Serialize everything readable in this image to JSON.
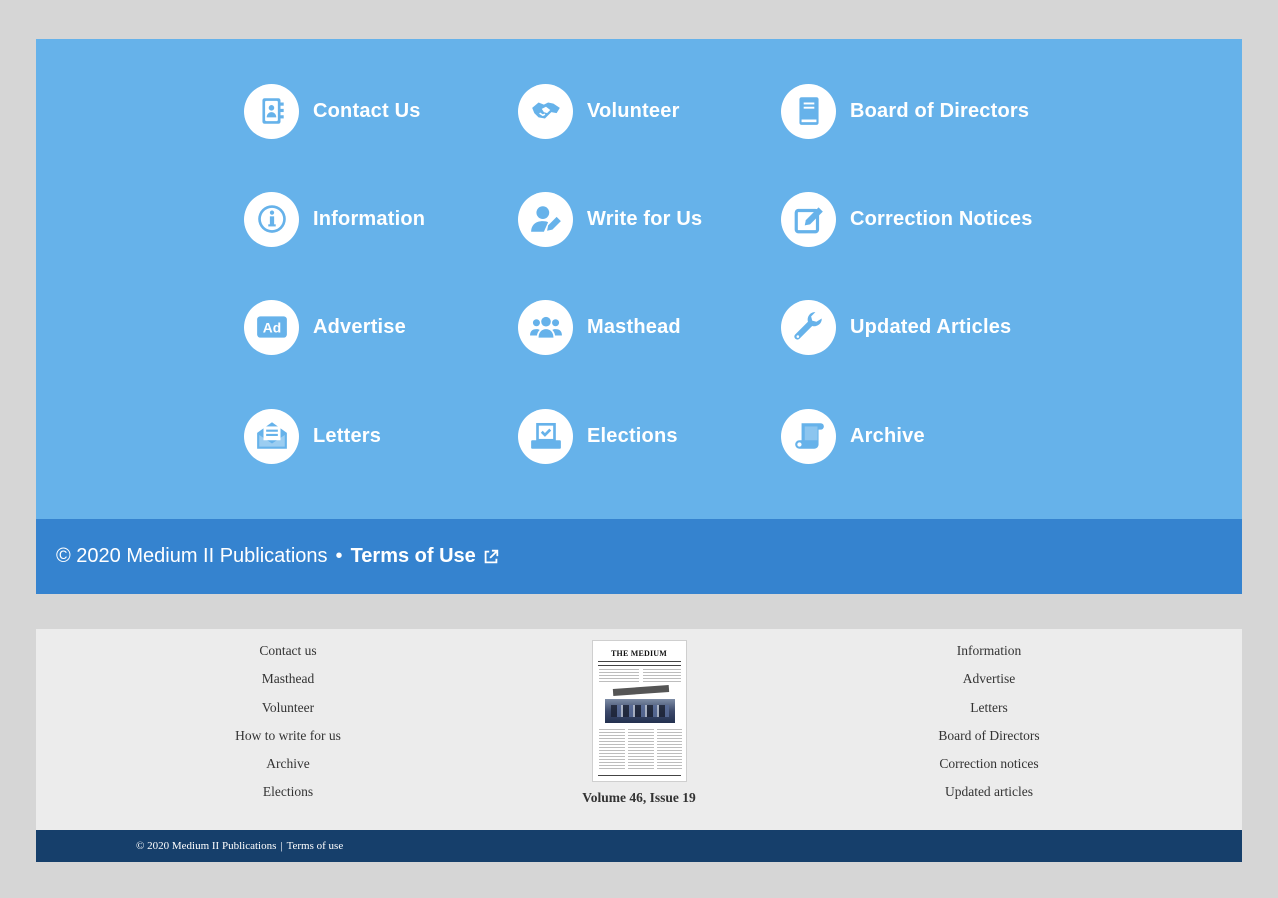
{
  "colors": {
    "page_background": "#d6d6d6",
    "icon_panel": "#66b2ea",
    "copyright_bar": "#3583cf",
    "icon_foreground": "#66b2ea",
    "bottom_panel": "#ececec",
    "bottom_bar": "#163f6b"
  },
  "quick_links": [
    {
      "label": "Contact Us",
      "icon": "contact-book-icon"
    },
    {
      "label": "Volunteer",
      "icon": "handshake-icon"
    },
    {
      "label": "Board of Directors",
      "icon": "book-icon"
    },
    {
      "label": "Information",
      "icon": "info-icon"
    },
    {
      "label": "Write for Us",
      "icon": "user-pen-icon"
    },
    {
      "label": "Correction Notices",
      "icon": "edit-icon"
    },
    {
      "label": "Advertise",
      "icon": "ad-icon"
    },
    {
      "label": "Masthead",
      "icon": "users-icon"
    },
    {
      "label": "Updated Articles",
      "icon": "wrench-icon"
    },
    {
      "label": "Letters",
      "icon": "envelope-open-icon"
    },
    {
      "label": "Elections",
      "icon": "vote-box-icon"
    },
    {
      "label": "Archive",
      "icon": "scroll-icon"
    }
  ],
  "copyright": {
    "text": "© 2020 Medium II Publications",
    "bullet": "•",
    "terms_label": "Terms of Use",
    "terms_icon": "external-link-icon"
  },
  "secondary_footer": {
    "left_links": [
      "Contact us",
      "Masthead",
      "Volunteer",
      "How to write for us",
      "Archive",
      "Elections"
    ],
    "right_links": [
      "Information",
      "Advertise",
      "Letters",
      "Board of Directors",
      "Correction notices",
      "Updated articles"
    ],
    "issue": {
      "masthead": "THE MEDIUM",
      "caption": "Volume 46, Issue 19"
    }
  },
  "bottom_bar": {
    "text": "© 2020 Medium II Publications",
    "separator": "|",
    "terms_label": "Terms of use"
  }
}
